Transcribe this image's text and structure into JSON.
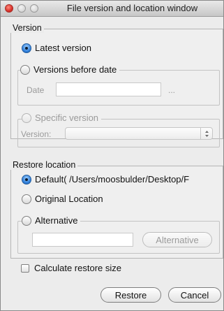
{
  "window": {
    "title": "File version and location window"
  },
  "version": {
    "legend": "Version",
    "latest_label": "Latest version",
    "before_date_label": "Versions before date",
    "date_label": "Date",
    "date_value": "",
    "date_button": "...",
    "specific_label": "Specific version",
    "version_label": "Version:",
    "version_value": "",
    "selected": "latest"
  },
  "restore_location": {
    "legend": "Restore location",
    "default_label": "Default( /Users/moosbulder/Desktop/F",
    "original_label": "Original Location",
    "alternative_label": "Alternative",
    "alternative_value": "",
    "alternative_button": "Alternative",
    "selected": "default"
  },
  "options": {
    "calculate_restore_size_label": "Calculate restore size",
    "calculate_restore_size_checked": false
  },
  "buttons": {
    "restore_label": "Restore",
    "cancel_label": "Cancel"
  }
}
